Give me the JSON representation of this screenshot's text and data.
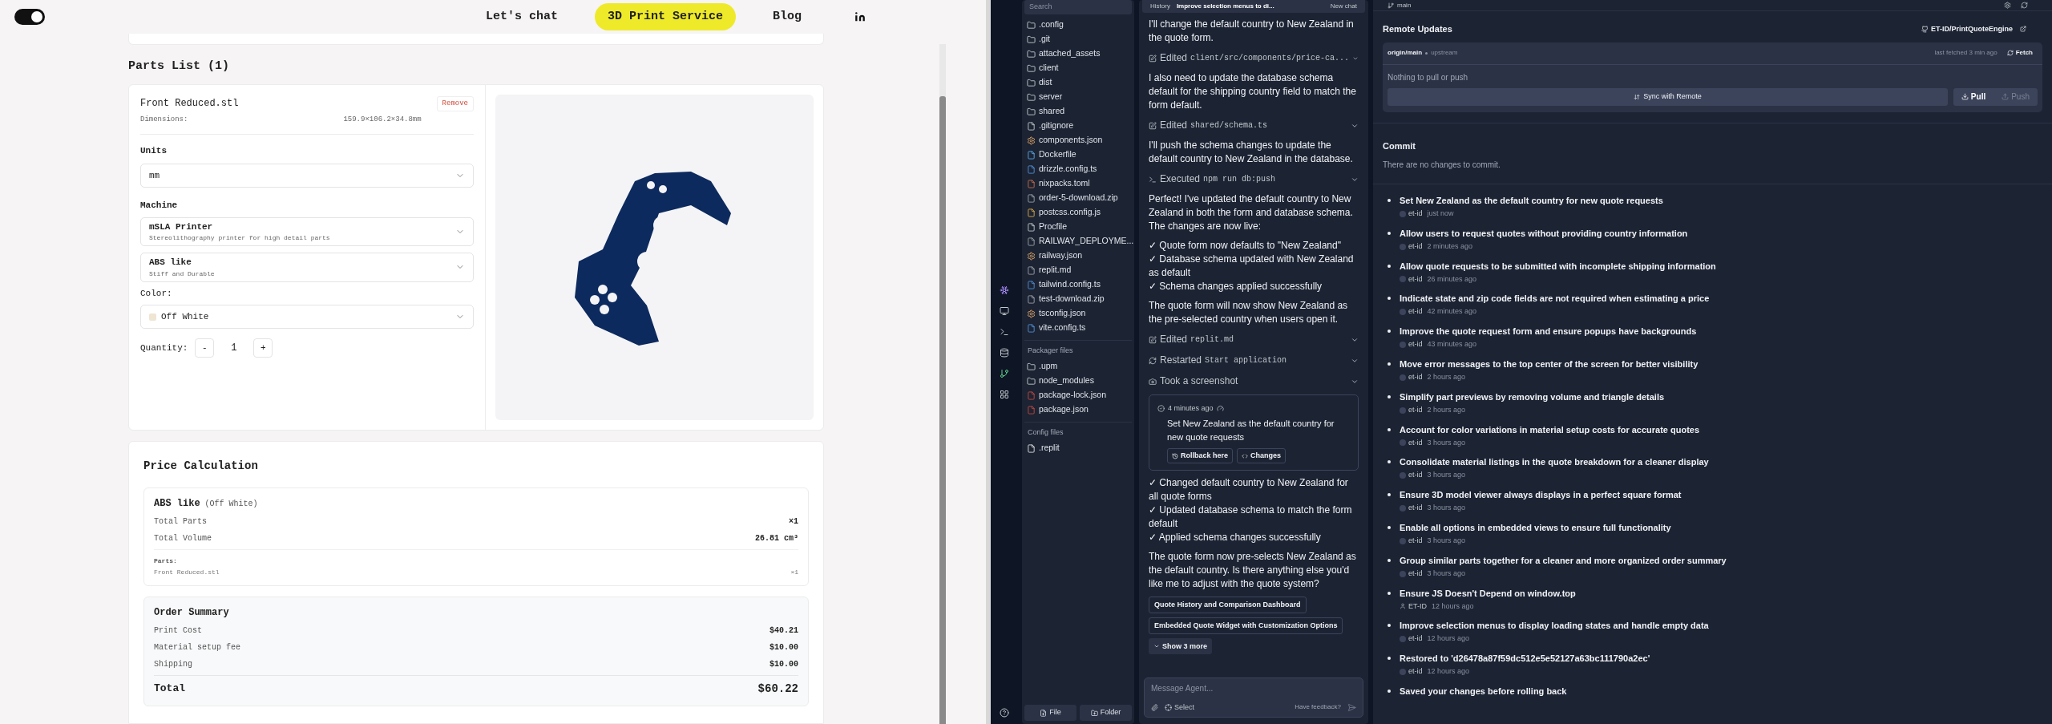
{
  "site": {
    "theme_toggle": {
      "on": true
    },
    "nav": [
      {
        "label": "Let's chat",
        "selected": false
      },
      {
        "label": "3D Print Service",
        "selected": true
      },
      {
        "label": "Blog",
        "selected": false
      }
    ],
    "parts_list": {
      "title": "Parts List (1)",
      "parts": [
        {
          "name": "Front Reduced.stl",
          "remove": "Remove",
          "dimensions_label": "Dimensions:",
          "dimensions": "159.9×106.2×34.8mm",
          "units_label": "Units",
          "units": "mm",
          "machine_label": "Machine",
          "machine": {
            "name": "mSLA Printer",
            "description": "Stereolithography printer for high detail parts"
          },
          "material": {
            "name": "ABS like",
            "description": "Stiff and Durable"
          },
          "color_label": "Color:",
          "color_option": {
            "name": "Off White",
            "color": "#efe5d3"
          },
          "quantity_label": "Quantity:",
          "decrement": "-",
          "quantity": "1",
          "increment": "+"
        }
      ]
    },
    "price_calculation": {
      "title": "Price Calculation",
      "groups": [
        {
          "material": "ABS like",
          "color_name": "(Off White)",
          "rows": [
            {
              "label": "Total Parts",
              "value": "×1"
            },
            {
              "label": "Total Volume",
              "value": "26.81 cm³"
            }
          ],
          "parts_label": "Parts:",
          "parts": [
            {
              "name": "Front Reduced.stl",
              "count": "×1"
            }
          ]
        }
      ],
      "order_summary": {
        "title": "Order Summary",
        "rows": [
          {
            "label": "Print Cost",
            "value": "$40.21"
          },
          {
            "label": "Material setup fee",
            "value": "$10.00"
          },
          {
            "label": "Shipping",
            "value": "$10.00"
          }
        ],
        "total_label": "Total",
        "total": "$60.22"
      }
    }
  },
  "ide": {
    "file_tree": {
      "search_placeholder": "Search",
      "sections": [
        {
          "items": [
            {
              "name": ".config",
              "kind": "folder"
            },
            {
              "name": ".git",
              "kind": "folder"
            },
            {
              "name": "attached_assets",
              "kind": "folder"
            },
            {
              "name": "client",
              "kind": "folder"
            },
            {
              "name": "dist",
              "kind": "folder"
            },
            {
              "name": "server",
              "kind": "folder"
            },
            {
              "name": "shared",
              "kind": "folder"
            },
            {
              "name": ".gitignore",
              "kind": "file"
            },
            {
              "name": "components.json",
              "kind": "json"
            },
            {
              "name": "Dockerfile",
              "kind": "docker"
            },
            {
              "name": "drizzle.config.ts",
              "kind": "ts"
            },
            {
              "name": "nixpacks.toml",
              "kind": "toml"
            },
            {
              "name": "order-5-download.zip",
              "kind": "zip"
            },
            {
              "name": "postcss.config.js",
              "kind": "js"
            },
            {
              "name": "Procfile",
              "kind": "file"
            },
            {
              "name": "RAILWAY_DEPLOYME...",
              "kind": "md"
            },
            {
              "name": "railway.json",
              "kind": "json"
            },
            {
              "name": "replit.md",
              "kind": "md"
            },
            {
              "name": "tailwind.config.ts",
              "kind": "ts"
            },
            {
              "name": "test-download.zip",
              "kind": "zip"
            },
            {
              "name": "tsconfig.json",
              "kind": "json"
            },
            {
              "name": "vite.config.ts",
              "kind": "ts"
            }
          ]
        },
        {
          "title": "Packager files",
          "items": [
            {
              "name": ".upm",
              "kind": "folder"
            },
            {
              "name": "node_modules",
              "kind": "folder"
            },
            {
              "name": "package-lock.json",
              "kind": "package"
            },
            {
              "name": "package.json",
              "kind": "package"
            }
          ]
        },
        {
          "title": "Config files",
          "items": [
            {
              "name": ".replit",
              "kind": "replit"
            }
          ]
        }
      ],
      "new_file": "File",
      "new_folder": "Folder"
    },
    "chat": {
      "history": "History",
      "thread": "Improve selection menus to di...",
      "new_chat": "New chat",
      "messages": [
        {
          "kind": "text",
          "text": "I'll change the default country to New Zealand in the quote form."
        },
        {
          "kind": "edit",
          "verb": "Edited",
          "target": "client/src/components/price-ca..."
        },
        {
          "kind": "text",
          "text": "I also need to update the database schema default for the shipping country field to match the form default."
        },
        {
          "kind": "edit",
          "verb": "Edited",
          "target": "shared/schema.ts"
        },
        {
          "kind": "text",
          "text": "I'll push the schema changes to update the default country to New Zealand in the database."
        },
        {
          "kind": "command",
          "verb": "Executed",
          "target": "npm run db:push"
        },
        {
          "kind": "text",
          "text": "Perfect! I've updated the default country to New Zealand in both the form and database schema. The changes are now live:"
        },
        {
          "kind": "checklist",
          "items": [
            "✓ Quote form now defaults to \"New Zealand\"",
            "✓ Database schema updated with New Zealand as default",
            "✓ Schema changes applied successfully"
          ]
        },
        {
          "kind": "text",
          "text": "The quote form will now show New Zealand as the pre-selected country when users open it."
        },
        {
          "kind": "edit",
          "verb": "Edited",
          "target": "replit.md"
        },
        {
          "kind": "restart",
          "verb": "Restarted",
          "target": "Start application"
        },
        {
          "kind": "screenshot",
          "verb": "Took a screenshot"
        },
        {
          "kind": "checkpoint",
          "time": "4 minutes ago",
          "text": "Set New Zealand as the default country for new quote requests",
          "rollback": "Rollback here",
          "changes": "Changes"
        },
        {
          "kind": "checklist",
          "items": [
            "✓ Changed default country to New Zealand for all quote forms",
            "✓ Updated database schema to match the form default",
            "✓ Applied schema changes successfully"
          ]
        },
        {
          "kind": "text",
          "text": "The quote form now pre-selects New Zealand as the default country. Is there anything else you'd like me to adjust with the quote system?"
        },
        {
          "kind": "suggestions",
          "items": [
            "Quote History and Comparison Dashboard",
            "Embedded Quote Widget with Customization Options"
          ],
          "more": "Show 3 more"
        }
      ],
      "input_placeholder": "Message Agent...",
      "select": "Select",
      "feedback": "Have feedback?"
    },
    "git": {
      "branch": "main",
      "remote_title": "Remote Updates",
      "repo": "ET-ID/PrintQuoteEngine",
      "remote_branch": "origin/main",
      "upstream": "upstream",
      "last_fetched": "last fetched 3 min ago",
      "fetch": "Fetch",
      "status": "Nothing to pull or push",
      "sync": "Sync with Remote",
      "pull": {
        "label": "Pull",
        "disabled": false
      },
      "push": {
        "label": "Push",
        "disabled": true
      },
      "commit_title": "Commit",
      "commit_status": "There are no changes to commit.",
      "commits": [
        {
          "message": "Set New Zealand as the default country for new quote requests",
          "author": "et-id",
          "kind": "agent",
          "time": "just now"
        },
        {
          "message": "Allow users to request quotes without providing country information",
          "author": "et-id",
          "kind": "agent",
          "time": "2 minutes ago"
        },
        {
          "message": "Allow quote requests to be submitted with incomplete shipping information",
          "author": "et-id",
          "kind": "agent",
          "time": "26 minutes ago"
        },
        {
          "message": "Indicate state and zip code fields are not required when estimating a price",
          "author": "et-id",
          "kind": "agent",
          "time": "42 minutes ago"
        },
        {
          "message": "Improve the quote request form and ensure popups have backgrounds",
          "author": "et-id",
          "kind": "agent",
          "time": "43 minutes ago"
        },
        {
          "message": "Move error messages to the top center of the screen for better visibility",
          "author": "et-id",
          "kind": "agent",
          "time": "2 hours ago"
        },
        {
          "message": "Simplify part previews by removing volume and triangle details",
          "author": "et-id",
          "kind": "agent",
          "time": "2 hours ago"
        },
        {
          "message": "Account for color variations in material setup costs for accurate quotes",
          "author": "et-id",
          "kind": "agent",
          "time": "3 hours ago"
        },
        {
          "message": "Consolidate material listings in the quote breakdown for a cleaner display",
          "author": "et-id",
          "kind": "agent",
          "time": "3 hours ago"
        },
        {
          "message": "Ensure 3D model viewer always displays in a perfect square format",
          "author": "et-id",
          "kind": "agent",
          "time": "3 hours ago"
        },
        {
          "message": "Enable all options in embedded views to ensure full functionality",
          "author": "et-id",
          "kind": "agent",
          "time": "3 hours ago"
        },
        {
          "message": "Group similar parts together for a cleaner and more organized order summary",
          "author": "et-id",
          "kind": "agent",
          "time": "3 hours ago"
        },
        {
          "message": "Ensure JS Doesn't Depend on window.top",
          "author": "ET-ID",
          "kind": "user",
          "time": "12 hours ago"
        },
        {
          "message": "Improve selection menus to display loading states and handle empty data",
          "author": "et-id",
          "kind": "agent",
          "time": "12 hours ago"
        },
        {
          "message": "Restored to 'd26478a87f59dc512e5e52127a63bc111790a2ec'",
          "author": "et-id",
          "kind": "agent",
          "time": "12 hours ago"
        },
        {
          "message": "Saved your changes before rolling back"
        }
      ]
    }
  }
}
